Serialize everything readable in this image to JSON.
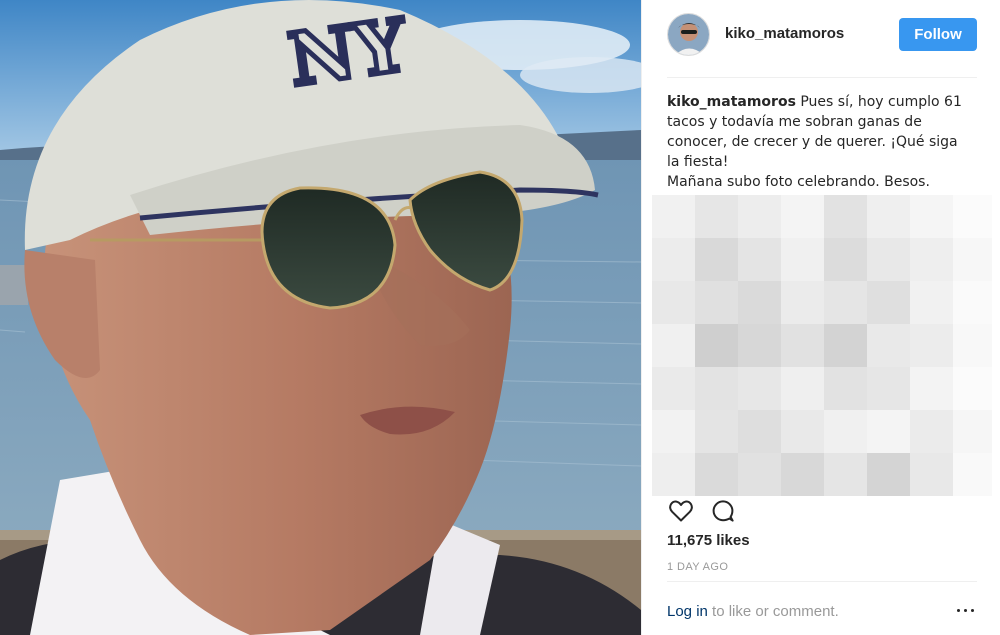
{
  "post": {
    "username": "kiko_matamoros",
    "follow_label": "Follow",
    "caption": {
      "username": "kiko_matamoros",
      "line1_text": "Pues sí, hoy cumplo 61",
      "line2": "tacos y todavía me sobran ganas de",
      "line3": "conocer, de crecer y de querer. ¡Qué siga",
      "line4": "la fiesta!",
      "line5": "Mañana subo foto celebrando. Besos."
    },
    "likes": "11,675 likes",
    "timestamp": "1 DAY AGO",
    "comment_prompt": {
      "login_link": "Log in",
      "rest": " to like or comment."
    }
  },
  "icons": [
    "heart-icon",
    "comment-icon",
    "more-options-icon"
  ],
  "colors": {
    "follow_button": "#3897f0",
    "link": "#003569",
    "muted_text": "#999999",
    "divider": "#efefef"
  }
}
